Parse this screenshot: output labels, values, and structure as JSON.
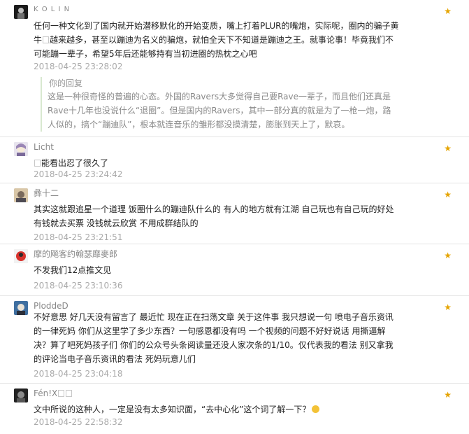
{
  "comments": [
    {
      "name": "K O L I N",
      "text_a": "任何一种文化到了国内就开始潜移默化的开始变质，嘴上打着PLUR的嘴炮，实际呢，圈内的骗子黄牛",
      "text_b": "越来越多，甚至以蹦迪为名义的骗炮，就怕全天下不知道是蹦迪之王。就事论事！毕竟我们不可能蹦一辈子，希望5年后还能够持有当初进圈的热枕之心吧",
      "time": "2018-04-25 23:28:02",
      "reply_label": "你的回复",
      "reply_text": "这是一种很奇怪的普遍的心态。外国的Ravers大多觉得自己要Rave一辈子，而且他们还真是Rave十几年也没说什么“退圈”。但是国内的Ravers，其中一部分真的就是为了一枪一炮，路人似的，搞个“蹦迪队”，根本就连音乐的雏形都没摸清楚，膨胀到天上了，默哀。"
    },
    {
      "name": "Licht",
      "text": "能看出忍了很久了",
      "time": "2018-04-25 23:24:42"
    },
    {
      "name": "彝十二",
      "text": "其实这就跟追星一个道理 饭圈什么的蹦迪队什么的 有人的地方就有江湖 自己玩也有自己玩的好处 有钱就去买票 没钱就云欣赏 不用成群结队的",
      "time": "2018-04-25 23:21:51"
    },
    {
      "name": "摩的飚客约翰瑟靡麥郎",
      "text": "不发我们12点推文见",
      "time": "2018-04-25 23:10:36"
    },
    {
      "name": "PloddeD",
      "text": "不好意思 好几天没有留言了 最近忙 现在正在扫荡文章 关于这件事 我只想说一句 喷电子音乐资讯的一律死妈 你们从这里学了多少东西？一句感恩都没有吗 一个视频的问题不好好说话 用撕逼解决？算了吧死妈孩子们 你们的公众号头条阅读量还没人家次条的1/10。仅代表我的看法 别又拿我的评论当电子音乐资讯的看法 死妈玩意儿们",
      "time": "2018-04-25 23:04:18"
    },
    {
      "name": "Fén!X",
      "text": "文中所说的这种人，一定是没有太多知识面，“去中心化”这个词了解一下？",
      "time": "2018-04-25 22:58:32"
    }
  ],
  "star_icon": "★",
  "colors": {
    "star": "#e5a400",
    "time": "#aaaaaa",
    "name": "#888888",
    "reply_bar": "#d8e8d0"
  }
}
